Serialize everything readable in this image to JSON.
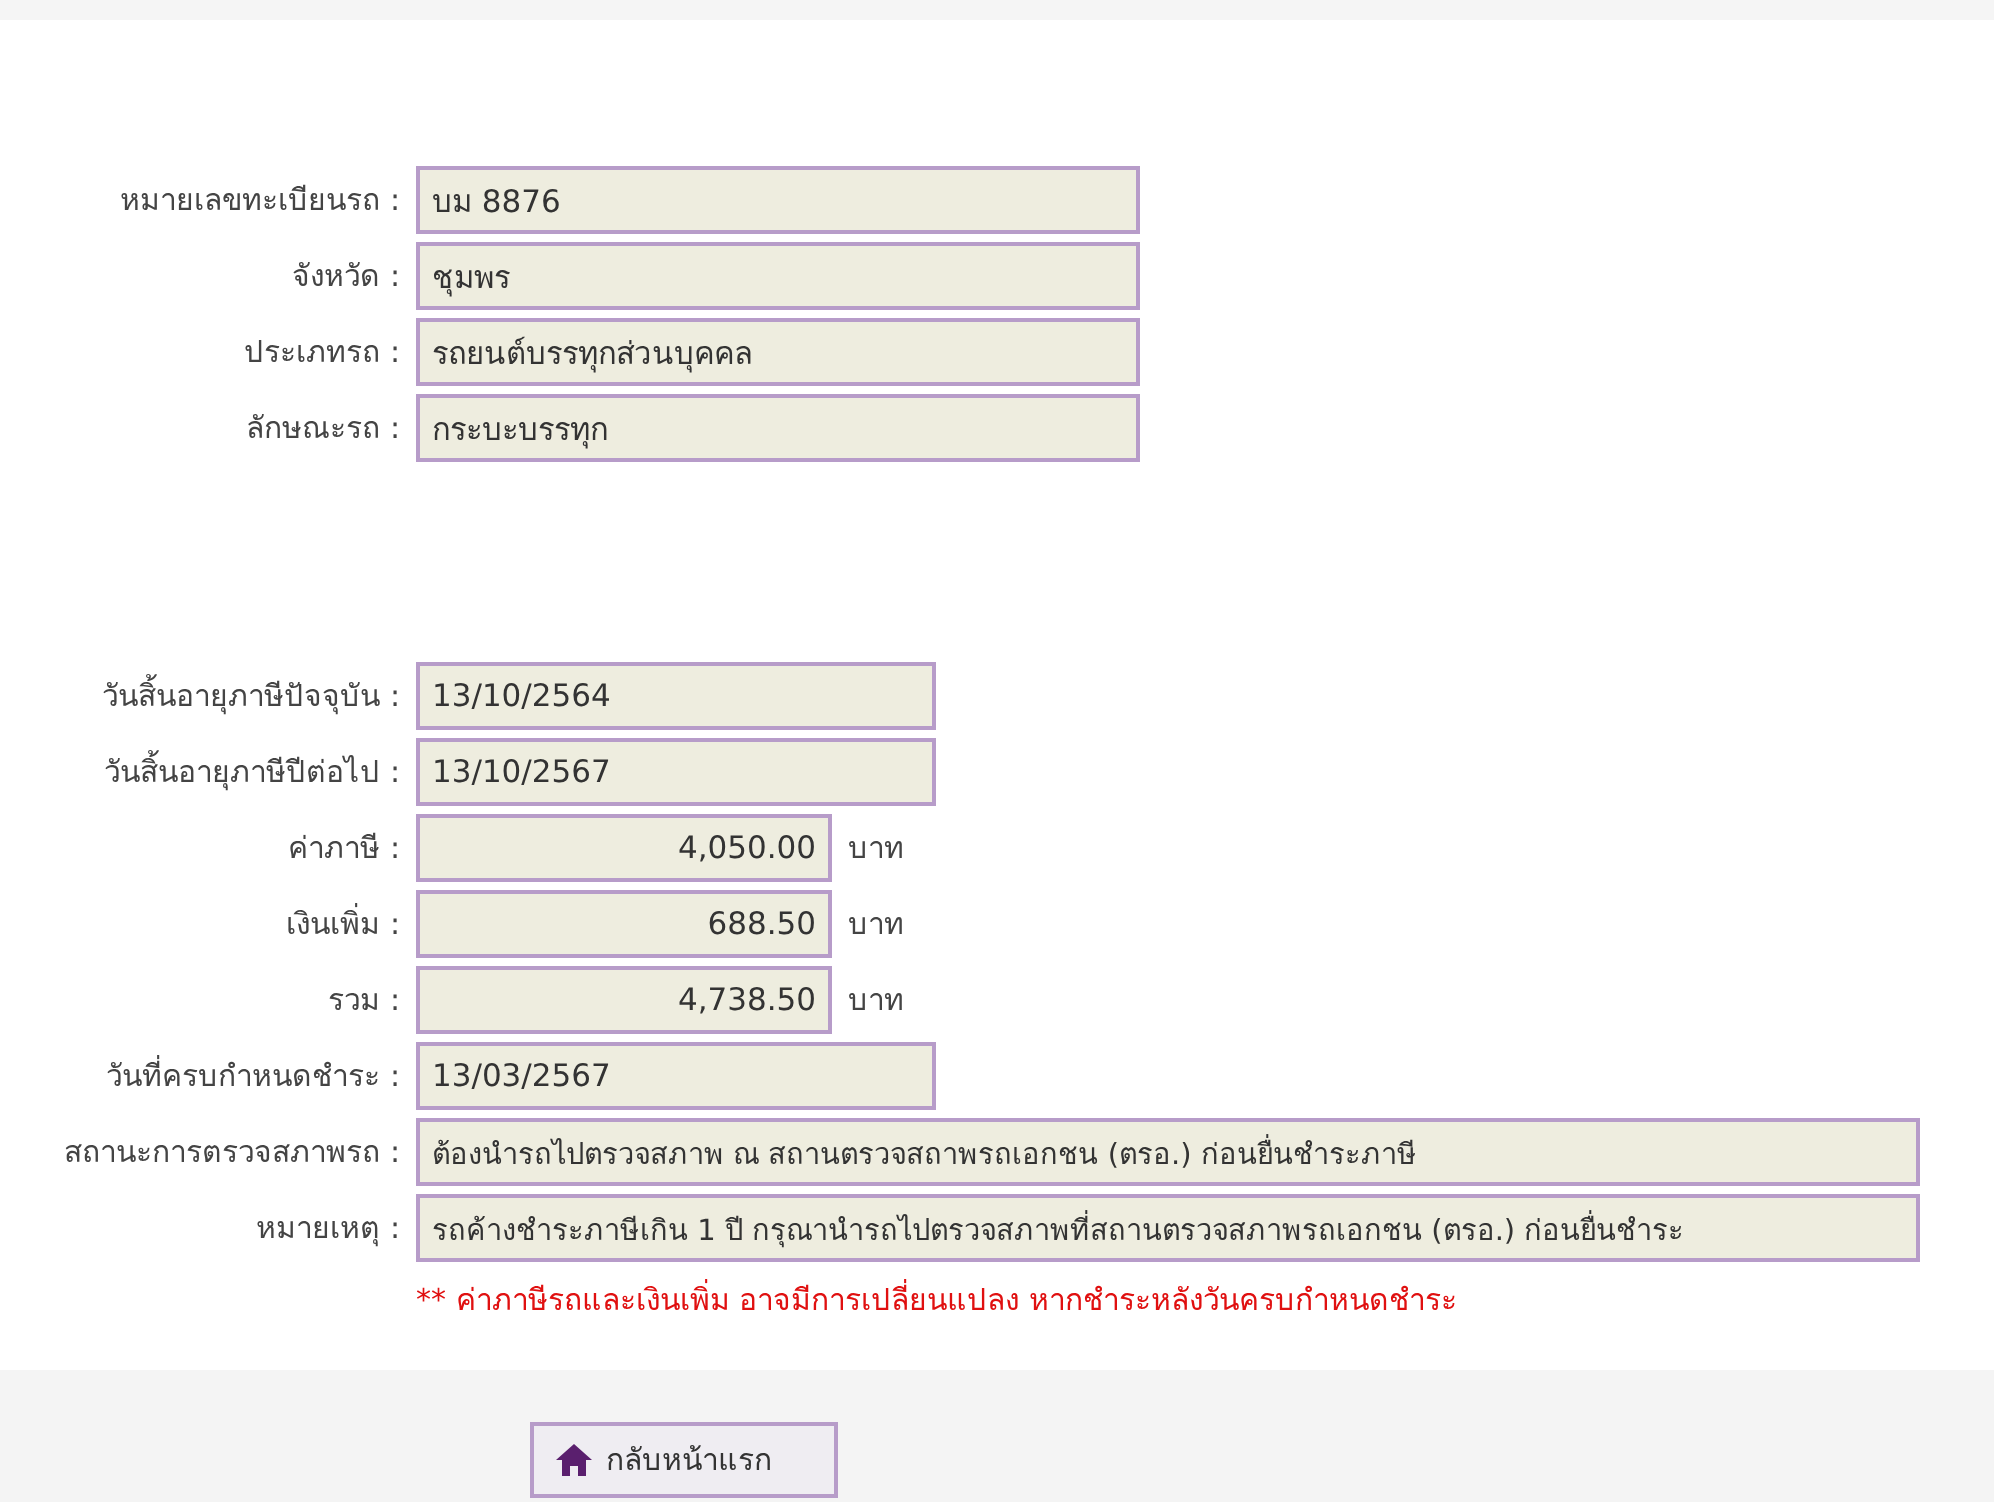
{
  "vehicle": [
    {
      "label": "หมายเลขทะเบียนรถ :",
      "value": "บม 8876",
      "kind": "short"
    },
    {
      "label": "จังหวัด :",
      "value": "ชุมพร",
      "kind": "short"
    },
    {
      "label": "ประเภทรถ :",
      "value": "รถยนต์บรรทุกส่วนบุคคล",
      "kind": "short"
    },
    {
      "label": "ลักษณะรถ :",
      "value": "กระบะบรรทุก",
      "kind": "short"
    }
  ],
  "tax": [
    {
      "label": "วันสิ้นอายุภาษีปัจจุบัน :",
      "value": "13/10/2564",
      "kind": "date"
    },
    {
      "label": "วันสิ้นอายุภาษีปีต่อไป :",
      "value": "13/10/2567",
      "kind": "date"
    },
    {
      "label": "ค่าภาษี :",
      "value": "4,050.00",
      "kind": "money",
      "unit": "บาท"
    },
    {
      "label": "เงินเพิ่ม :",
      "value": "688.50",
      "kind": "money",
      "unit": "บาท"
    },
    {
      "label": "รวม :",
      "value": "4,738.50",
      "kind": "money",
      "unit": "บาท"
    },
    {
      "label": "วันที่ครบกำหนดชำระ :",
      "value": "13/03/2567",
      "kind": "date"
    },
    {
      "label": "สถานะการตรวจสภาพรถ :",
      "value": "ต้องนำรถไปตรวจสภาพ ณ สถานตรวจสถาพรถเอกชน (ตรอ.) ก่อนยื่นชำระภาษี",
      "kind": "long"
    },
    {
      "label": "หมายเหตุ :",
      "value": "รถค้างชำระภาษีเกิน 1 ปี กรุณานำรถไปตรวจสภาพที่สถานตรวจสภาพรถเอกชน (ตรอ.) ก่อนยื่นชำระ",
      "kind": "long"
    }
  ],
  "warning": "** ค่าภาษีรถและเงินเพิ่ม อาจมีการเปลี่ยนแปลง หากชำระหลังวันครบกำหนดชำระ",
  "back_button": "กลับหน้าแรก"
}
